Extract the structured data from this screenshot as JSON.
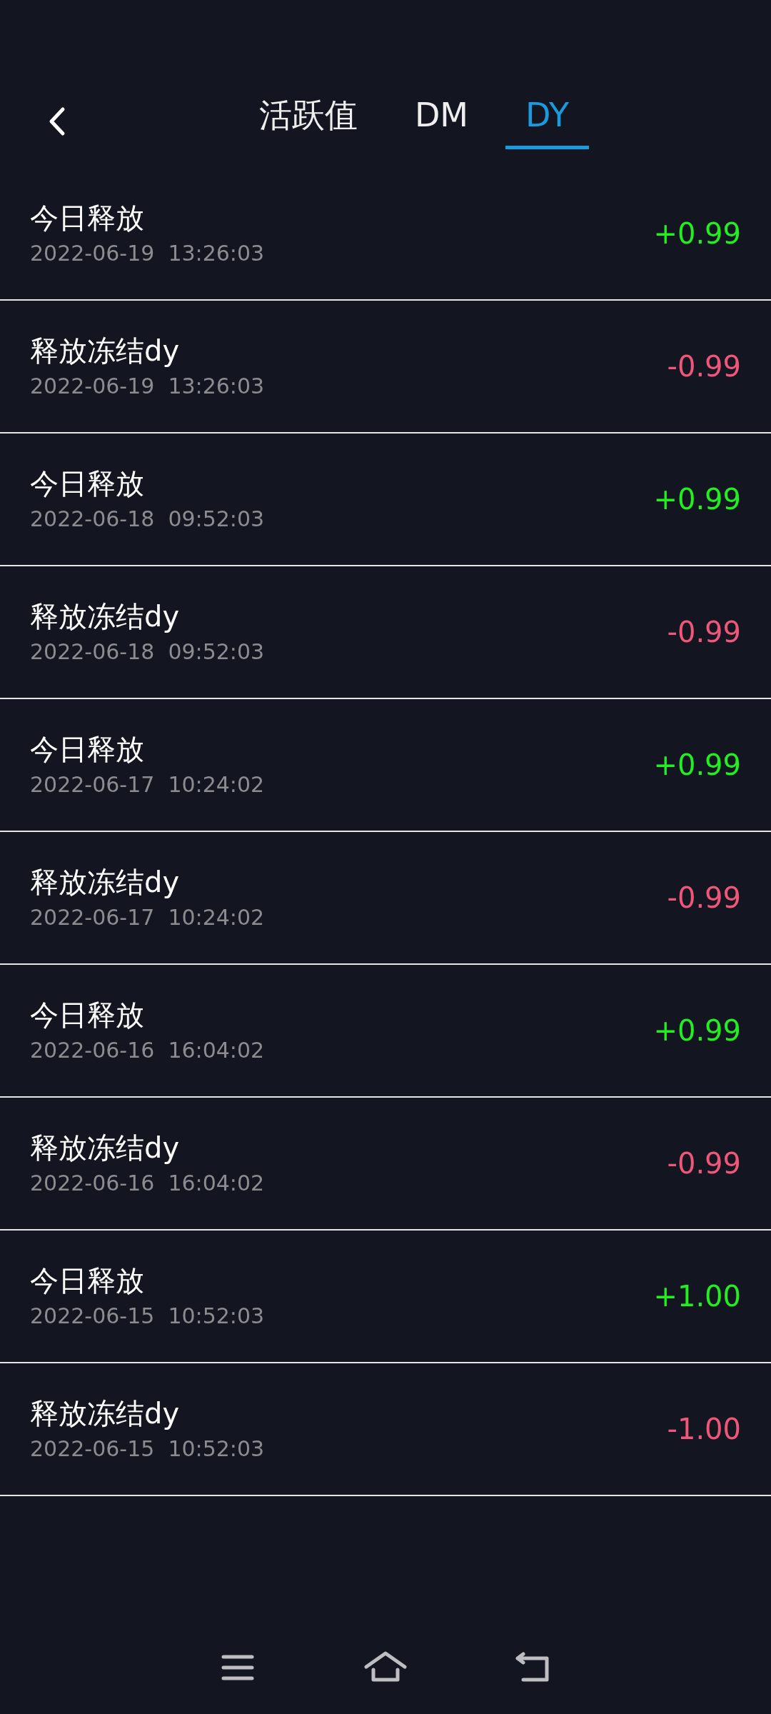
{
  "header": {
    "tabs": [
      {
        "label": "活跃值",
        "selected": false
      },
      {
        "label": "DM",
        "selected": false
      },
      {
        "label": "DY",
        "selected": true
      }
    ]
  },
  "records": [
    {
      "title": "今日释放",
      "time": "2022-06-19  13:26:03",
      "amount": "+0.99",
      "kind": "credit"
    },
    {
      "title": "释放冻结dy",
      "time": "2022-06-19  13:26:03",
      "amount": "-0.99",
      "kind": "debit"
    },
    {
      "title": "今日释放",
      "time": "2022-06-18  09:52:03",
      "amount": "+0.99",
      "kind": "credit"
    },
    {
      "title": "释放冻结dy",
      "time": "2022-06-18  09:52:03",
      "amount": "-0.99",
      "kind": "debit"
    },
    {
      "title": "今日释放",
      "time": "2022-06-17  10:24:02",
      "amount": "+0.99",
      "kind": "credit"
    },
    {
      "title": "释放冻结dy",
      "time": "2022-06-17  10:24:02",
      "amount": "-0.99",
      "kind": "debit"
    },
    {
      "title": "今日释放",
      "time": "2022-06-16  16:04:02",
      "amount": "+0.99",
      "kind": "credit"
    },
    {
      "title": "释放冻结dy",
      "time": "2022-06-16  16:04:02",
      "amount": "-0.99",
      "kind": "debit"
    },
    {
      "title": "今日释放",
      "time": "2022-06-15  10:52:03",
      "amount": "+1.00",
      "kind": "credit"
    },
    {
      "title": "释放冻结dy",
      "time": "2022-06-15  10:52:03",
      "amount": "-1.00",
      "kind": "debit"
    }
  ]
}
